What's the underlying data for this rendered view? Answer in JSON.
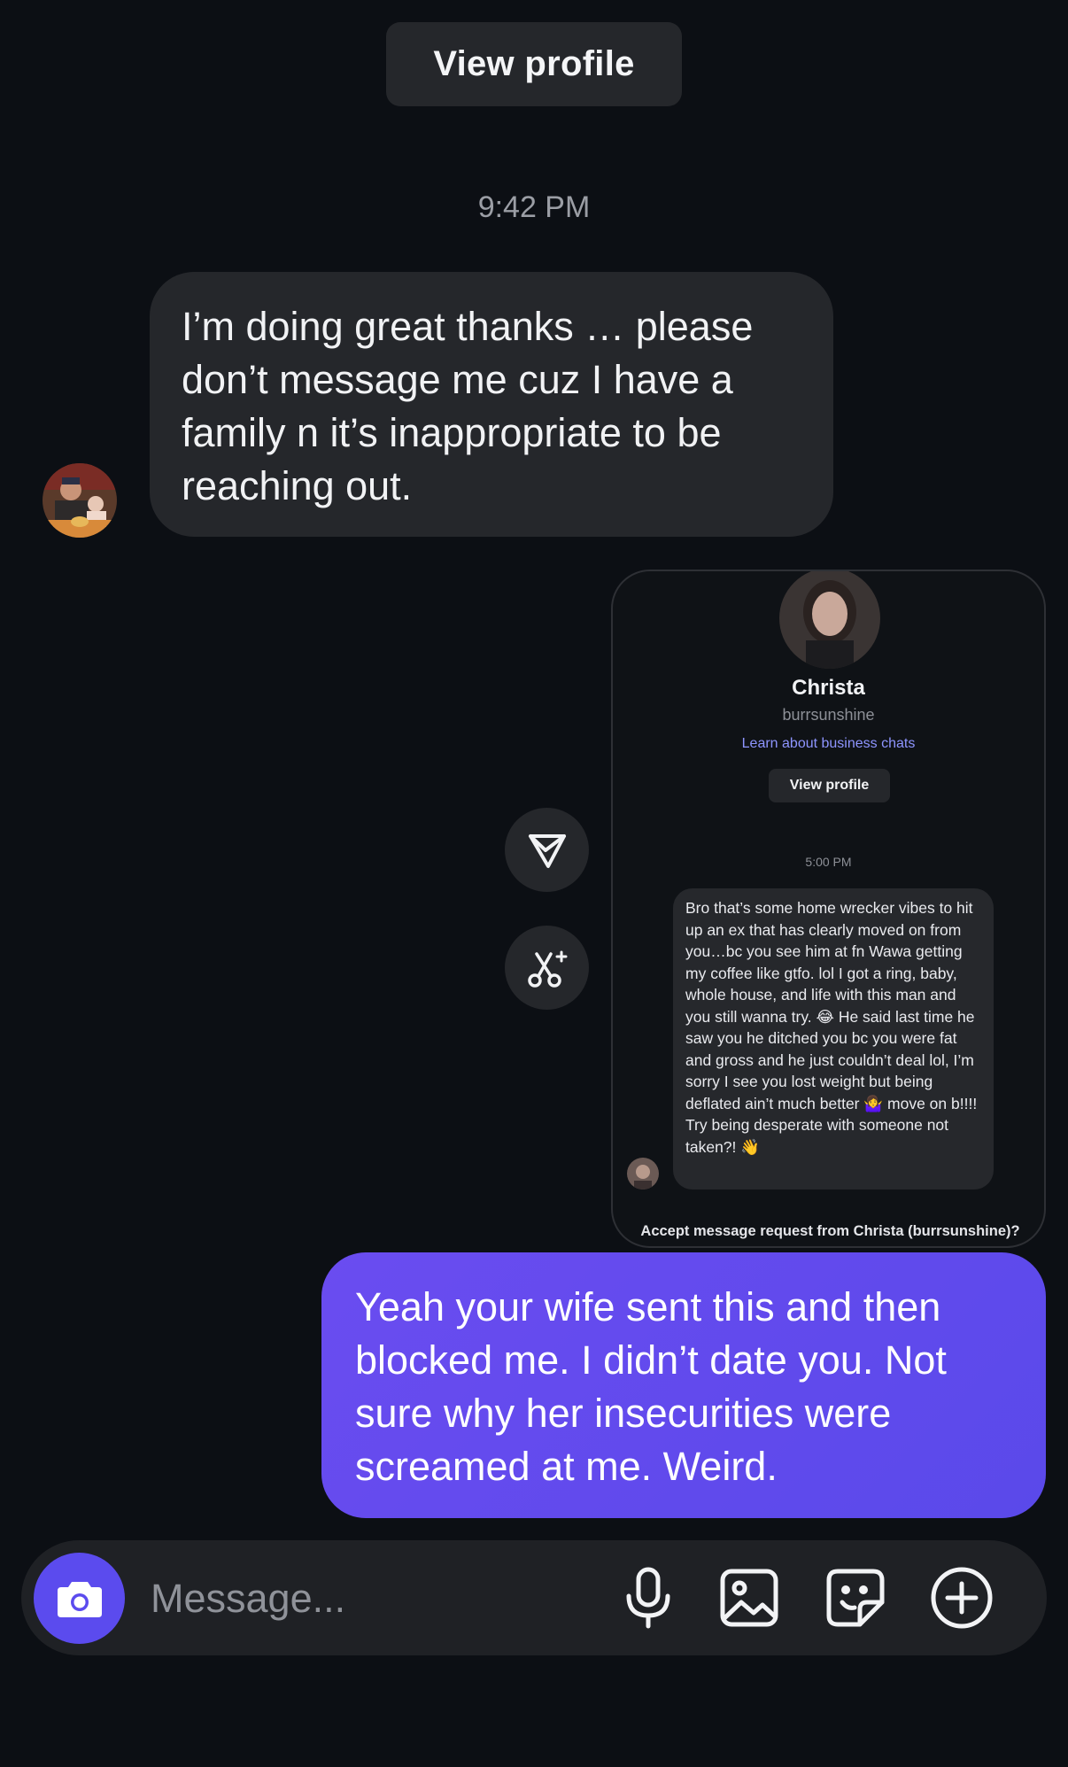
{
  "header": {
    "view_profile_label": "View profile",
    "timestamp": "9:42 PM"
  },
  "incoming_message": {
    "text": "I’m doing great thanks … please don’t message me cuz I have a family n it’s inappropriate to be reaching out."
  },
  "shared_screenshot": {
    "name": "Christa",
    "handle": "burrsunshine",
    "learn_link": "Learn about business chats",
    "view_profile_label": "View profile",
    "time": "5:00 PM",
    "message": "Bro that’s some home wrecker vibes to hit up an ex that has clearly moved on from you…bc you see him at fn Wawa getting my coffee like gtfo. lol I got a ring, baby, whole house, and life with this man and you still wanna try. 😂 He said last time he saw you he ditched you bc you were fat and gross and he just couldn’t deal lol, I’m sorry I see you lost weight but being deflated ain’t much better 🤷‍♀️ move on b!!!! Try being desperate with someone not taken?! 👋",
    "accept_prompt": "Accept message request from Christa (burrsunshine)?"
  },
  "outgoing_message": {
    "text": "Yeah your wife sent this and then blocked me. I didn’t date you. Not sure why her insecurities were screamed at me. Weird."
  },
  "composer": {
    "placeholder": "Message...",
    "icons": [
      "camera-icon",
      "microphone-icon",
      "gallery-icon",
      "sticker-icon",
      "plus-icon"
    ]
  },
  "colors": {
    "background": "#0c0f14",
    "bubble_in": "#25272b",
    "bubble_out": "#5a49ea",
    "accent": "#5b4bee"
  }
}
